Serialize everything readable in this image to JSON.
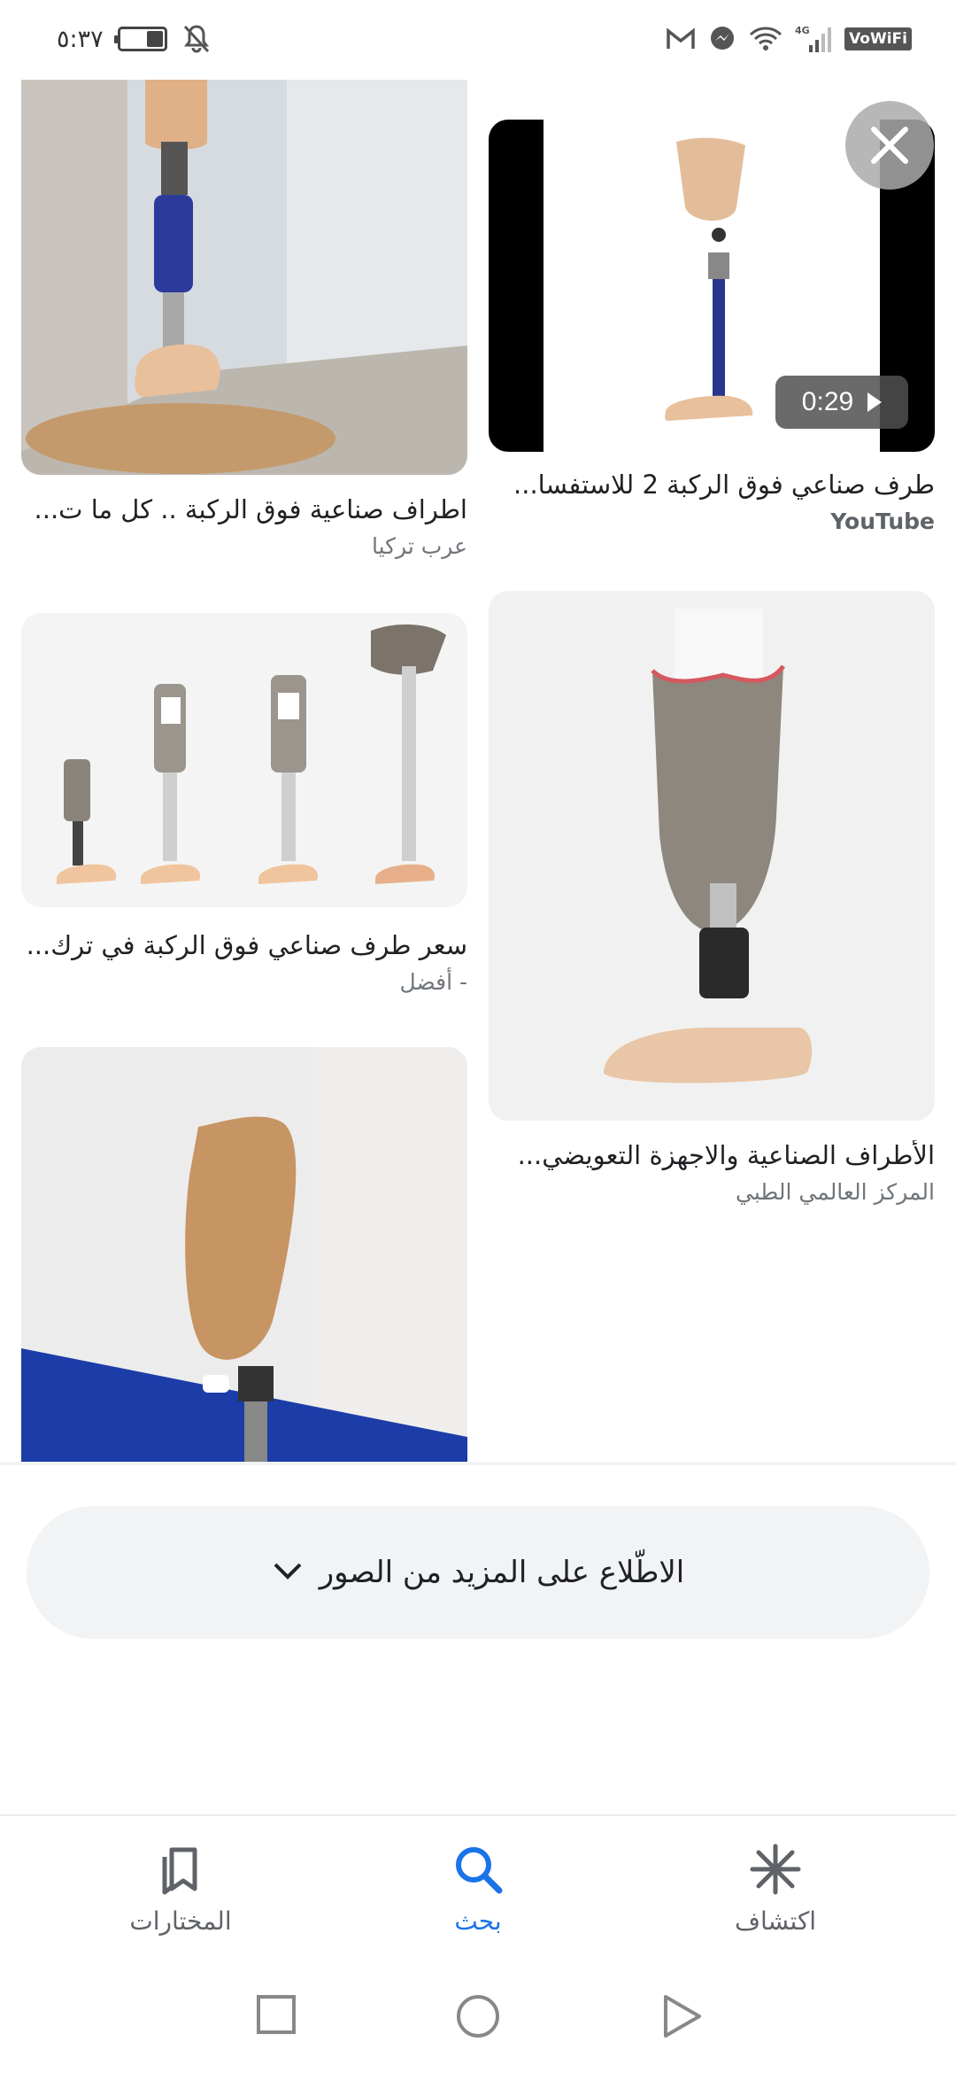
{
  "status_bar": {
    "time": "٥:٣٧",
    "network": "4G",
    "wifi_calling": "VoWiFi",
    "battery_level": 0.35
  },
  "results": [
    {
      "title": "اطراف صناعية فوق الركبة .. كل ما ت...",
      "source": "عرب تركيا"
    },
    {
      "title": "طرف صناعي فوق الركبة 2 للاستفسا...",
      "source": "YouTube",
      "duration": "0:29"
    },
    {
      "title": "سعر طرف صناعي فوق الركبة في ترك...",
      "source": "- أفضل"
    },
    {
      "title": "الأطراف الصناعية والاجهزة التعويضي...",
      "source": "المركز العالمي الطبي"
    },
    {
      "title": "",
      "source": ""
    }
  ],
  "more_button": {
    "label": "الاطّلاع على المزيد من الصور"
  },
  "bottom_nav": [
    {
      "label": "المختارات",
      "icon": "bookmarks-icon",
      "active": false
    },
    {
      "label": "بحث",
      "icon": "search-icon",
      "active": true
    },
    {
      "label": "اكتشاف",
      "icon": "discover-asterisk-icon",
      "active": false
    }
  ],
  "colors": {
    "accent": "#1a73e8",
    "surface": "#f1f3f4",
    "text_secondary": "#70757a"
  }
}
